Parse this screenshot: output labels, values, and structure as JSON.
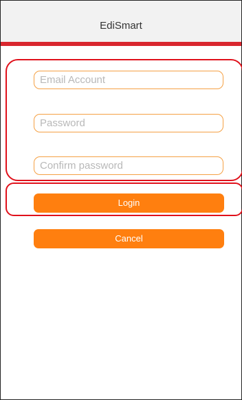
{
  "app": {
    "title": "EdiSmart"
  },
  "colors": {
    "accent_bar": "#d9262e",
    "button": "#ff7f0f",
    "field_border": "#f5a043",
    "highlight": "#e0101a"
  },
  "form": {
    "email": {
      "value": "",
      "placeholder": "Email Account"
    },
    "password": {
      "value": "",
      "placeholder": "Password"
    },
    "confirm_password": {
      "value": "",
      "placeholder": "Confirm password"
    }
  },
  "buttons": {
    "login_label": "Login",
    "cancel_label": "Cancel"
  }
}
